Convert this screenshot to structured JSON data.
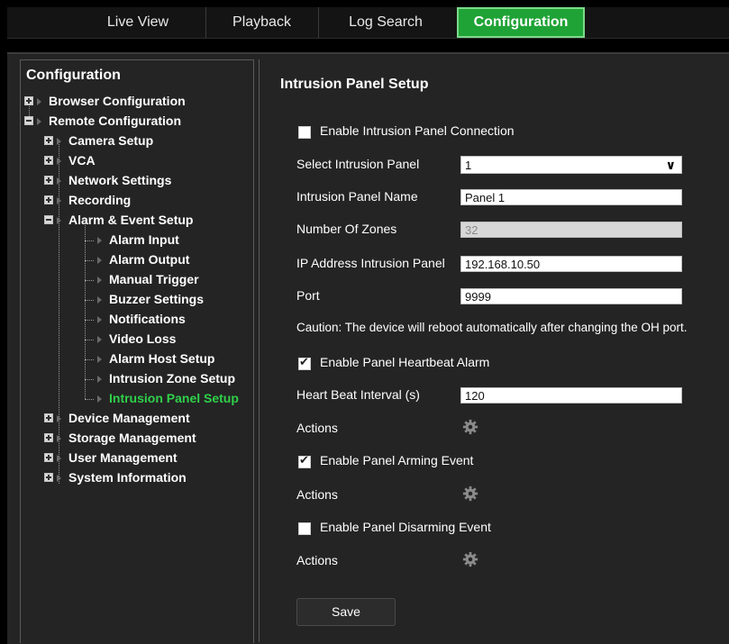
{
  "nav": {
    "tabs": [
      {
        "label": "Live View"
      },
      {
        "label": "Playback"
      },
      {
        "label": "Log Search"
      },
      {
        "label": "Configuration"
      }
    ],
    "active_color": "#1fa336"
  },
  "sidebar": {
    "title": "Configuration",
    "items": [
      {
        "label": "Browser Configuration"
      },
      {
        "label": "Remote Configuration"
      },
      {
        "label": "Camera Setup"
      },
      {
        "label": "VCA"
      },
      {
        "label": "Network Settings"
      },
      {
        "label": "Recording"
      },
      {
        "label": "Alarm & Event Setup"
      },
      {
        "label": "Alarm Input"
      },
      {
        "label": "Alarm Output"
      },
      {
        "label": "Manual Trigger"
      },
      {
        "label": "Buzzer Settings"
      },
      {
        "label": "Notifications"
      },
      {
        "label": "Video Loss"
      },
      {
        "label": "Alarm Host Setup"
      },
      {
        "label": "Intrusion Zone Setup"
      },
      {
        "label": "Intrusion Panel Setup"
      },
      {
        "label": "Device Management"
      },
      {
        "label": "Storage Management"
      },
      {
        "label": "User Management"
      },
      {
        "label": "System Information"
      }
    ],
    "active_color": "#2fd14a"
  },
  "main": {
    "title": "Intrusion Panel Setup",
    "enable_connection": {
      "label": "Enable Intrusion Panel Connection",
      "checked": false
    },
    "select_panel": {
      "label": "Select Intrusion Panel",
      "value": "1"
    },
    "panel_name": {
      "label": "Intrusion Panel Name",
      "value": "Panel 1"
    },
    "zones": {
      "label": "Number Of Zones",
      "value": "32"
    },
    "ip_address": {
      "label": "IP Address Intrusion Panel",
      "value": "192.168.10.50"
    },
    "port": {
      "label": "Port",
      "value": "9999"
    },
    "caution": "Caution: The device will reboot automatically after changing the OH port.",
    "heartbeat_alarm": {
      "label": "Enable Panel Heartbeat Alarm",
      "checked": true
    },
    "heartbeat_interval": {
      "label": "Heart Beat Interval (s)",
      "value": "120"
    },
    "actions_1": "Actions",
    "arming_event": {
      "label": "Enable Panel Arming Event",
      "checked": true
    },
    "actions_2": "Actions",
    "disarming_event": {
      "label": "Enable Panel Disarming Event",
      "checked": false
    },
    "actions_3": "Actions",
    "save_label": "Save"
  }
}
